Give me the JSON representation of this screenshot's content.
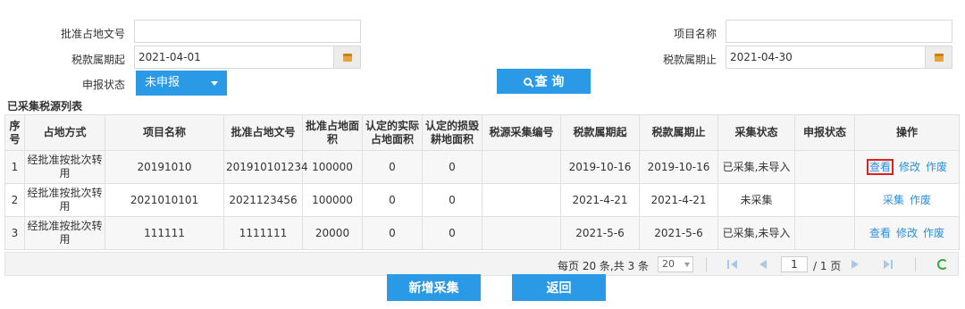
{
  "form": {
    "approval_doc_label": "批准占地文号",
    "approval_doc_value": "",
    "project_name_label": "项目名称",
    "project_name_value": "",
    "tax_start_label": "税款属期起",
    "tax_start_value": "2021-04-01",
    "tax_end_label": "税款属期止",
    "tax_end_value": "2021-04-30",
    "status_label": "申报状态",
    "status_value": "未申报",
    "search_label": "查 询"
  },
  "section_title": "已采集税源列表",
  "table": {
    "headers": [
      "序号",
      "占地方式",
      "项目名称",
      "批准占地文号",
      "批准占地面积",
      "认定的实际占地面积",
      "认定的损毁耕地面积",
      "税源采集编号",
      "税款属期起",
      "税款属期止",
      "采集状态",
      "申报状态",
      "操作"
    ],
    "rows": [
      {
        "index": "1",
        "method": "经批准按批次转用",
        "project": "20191010",
        "doc_no": "201910101234",
        "approved_area": "100000",
        "actual_area": "0",
        "damaged_area": "0",
        "collect_no": "",
        "start": "2019-10-16",
        "end": "2019-10-16",
        "collect_status": "已采集,未导入",
        "declare_status": "",
        "ops": [
          "查看",
          "修改",
          "作废"
        ]
      },
      {
        "index": "2",
        "method": "经批准按批次转用",
        "project": "2021010101",
        "doc_no": "2021123456",
        "approved_area": "100000",
        "actual_area": "0",
        "damaged_area": "0",
        "collect_no": "",
        "start": "2021-4-21",
        "end": "2021-4-21",
        "collect_status": "未采集",
        "declare_status": "",
        "ops": [
          "采集",
          "作废"
        ]
      },
      {
        "index": "3",
        "method": "经批准按批次转用",
        "project": "111111",
        "doc_no": "1111111",
        "approved_area": "20000",
        "actual_area": "0",
        "damaged_area": "0",
        "collect_no": "",
        "start": "2021-5-6",
        "end": "2021-5-6",
        "collect_status": "已采集,未导入",
        "declare_status": "",
        "ops": [
          "查看",
          "修改",
          "作废"
        ]
      }
    ]
  },
  "pager": {
    "info": "每页 20 条,共 3 条",
    "page_size": "20",
    "current_page": "1",
    "of_pages": "/ 1 页"
  },
  "buttons": {
    "add": "新增采集",
    "back": "返回"
  },
  "colors": {
    "accent": "#2b9ae6",
    "highlight_border": "#e02020"
  }
}
